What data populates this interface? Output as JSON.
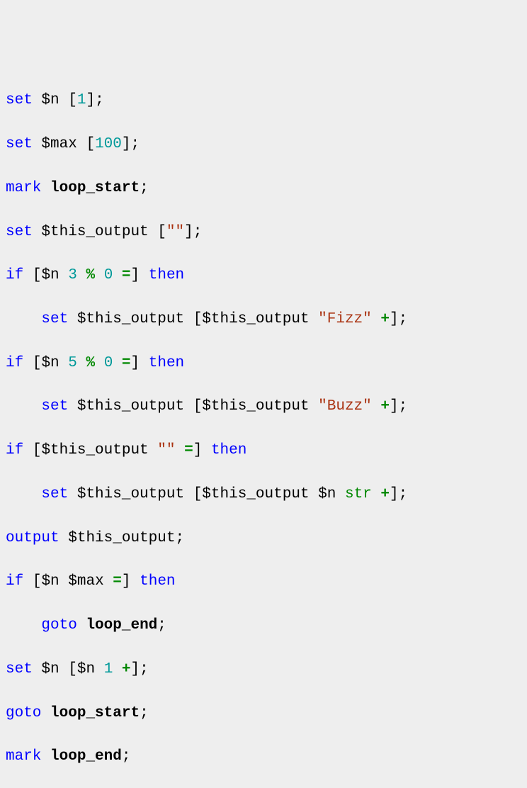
{
  "syntax": {
    "kw_set": "set",
    "kw_mark": "mark",
    "kw_if": "if",
    "kw_then": "then",
    "kw_goto": "goto",
    "kw_output": "output",
    "var_n": "$n",
    "var_max": "$max",
    "var_thisout": "$this_output",
    "num_1": "1",
    "num_100": "100",
    "num_3": "3",
    "num_5": "5",
    "num_0": "0",
    "op_mod": "%",
    "op_eq": "=",
    "op_plus": "+",
    "fn_str": "str",
    "str_empty": "\"\"",
    "str_fizz": "\"Fizz\"",
    "str_buzz": "\"Buzz\"",
    "lbl_start": "loop_start",
    "lbl_end": "loop_end",
    "lb": "[",
    "rb": "]",
    "semi": ";",
    "sp": " ",
    "indent": "    "
  }
}
